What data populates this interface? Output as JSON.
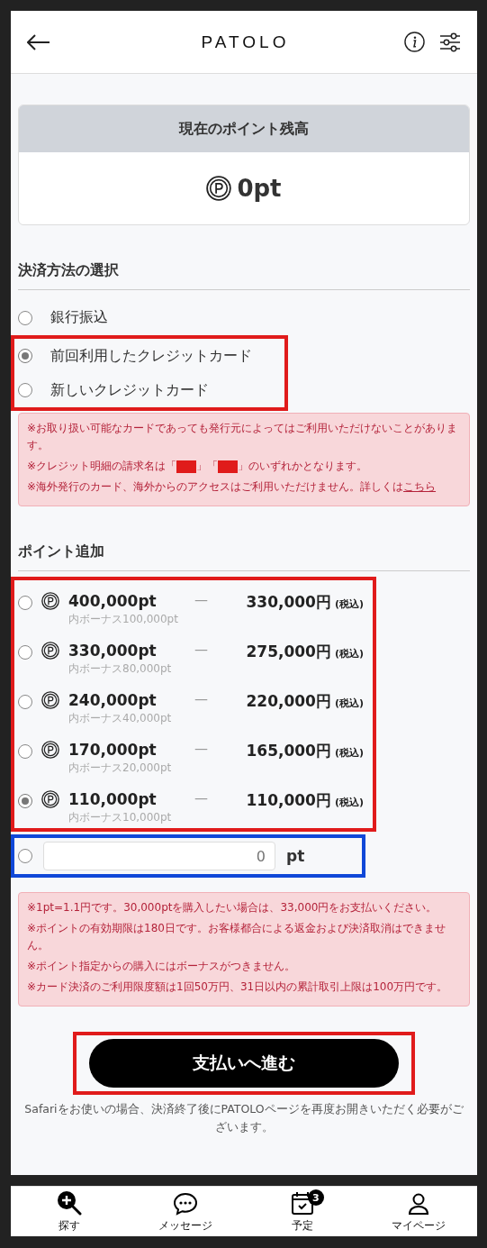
{
  "header": {
    "logo": "PATOLO"
  },
  "balance": {
    "title": "現在のポイント残高",
    "amount": "0pt"
  },
  "payment": {
    "title": "決済方法の選択",
    "options": [
      {
        "label": "銀行振込",
        "selected": false
      },
      {
        "label": "前回利用したクレジットカード",
        "selected": true
      },
      {
        "label": "新しいクレジットカード",
        "selected": false
      }
    ],
    "notes": [
      {
        "kind": "text",
        "text": "※お取り扱い可能なカードであっても発行元によってはご利用いただけないことがあります。"
      },
      {
        "kind": "redacted",
        "parts": [
          "※クレジット明細の請求名は「",
          "」「",
          "」のいずれかとなります。"
        ]
      },
      {
        "kind": "link",
        "text": "※海外発行のカード、海外からのアクセスはご利用いただけません。詳しくは",
        "link": "こちら"
      }
    ]
  },
  "points": {
    "title": "ポイント追加",
    "packages": [
      {
        "points": "400,000pt",
        "dash": "—",
        "price": "330,000円",
        "tax": "(税込)",
        "bonus": "内ボーナス100,000pt",
        "selected": false
      },
      {
        "points": "330,000pt",
        "dash": "—",
        "price": "275,000円",
        "tax": "(税込)",
        "bonus": "内ボーナス80,000pt",
        "selected": false
      },
      {
        "points": "240,000pt",
        "dash": "—",
        "price": "220,000円",
        "tax": "(税込)",
        "bonus": "内ボーナス40,000pt",
        "selected": false
      },
      {
        "points": "170,000pt",
        "dash": "—",
        "price": "165,000円",
        "tax": "(税込)",
        "bonus": "内ボーナス20,000pt",
        "selected": false
      },
      {
        "points": "110,000pt",
        "dash": "—",
        "price": "110,000円",
        "tax": "(税込)",
        "bonus": "内ボーナス10,000pt",
        "selected": true
      }
    ],
    "custom": {
      "placeholder": "0",
      "unit": "pt",
      "selected": false
    },
    "notes": [
      "※1pt=1.1円です。30,000ptを購入したい場合は、33,000円をお支払いください。",
      "※ポイントの有効期限は180日です。お客様都合による返金および決済取消はできません。",
      "※ポイント指定からの購入にはボーナスがつきません。",
      "※カード決済のご利用限度額は1回50万円、31日以内の累計取引上限は100万円です。"
    ]
  },
  "submit": {
    "label": "支払いへ進む"
  },
  "caption": "Safariをお使いの場合、決済終了後にPATOLOページを再度お開きいただく必要がございます。",
  "tabbar": [
    {
      "kind": "search",
      "label": "探す"
    },
    {
      "kind": "message",
      "label": "メッセージ"
    },
    {
      "kind": "calendar",
      "label": "予定",
      "badge": "3"
    },
    {
      "kind": "person",
      "label": "マイページ"
    }
  ]
}
